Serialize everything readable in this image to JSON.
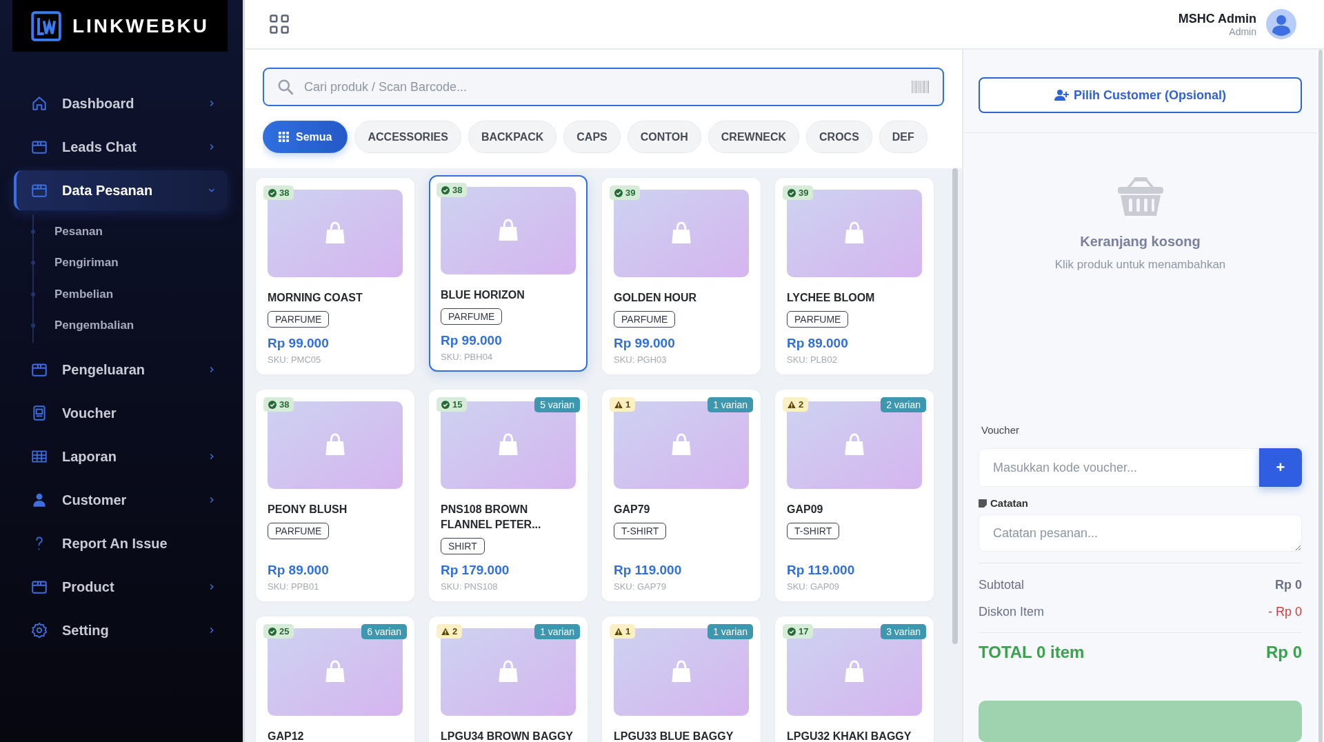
{
  "brand": {
    "name": "LINKWEBKU"
  },
  "sidebar": {
    "items": [
      {
        "label": "Dashboard",
        "kind": "home",
        "selected": false,
        "expanded": false
      },
      {
        "label": "Leads Chat",
        "kind": "box",
        "selected": false,
        "expanded": false
      },
      {
        "label": "Data Pesanan",
        "kind": "box",
        "selected": true,
        "expanded": true,
        "children": [
          {
            "label": "Pesanan"
          },
          {
            "label": "Pengiriman"
          },
          {
            "label": "Pembelian"
          },
          {
            "label": "Pengembalian"
          }
        ]
      },
      {
        "label": "Pengeluaran",
        "kind": "box",
        "selected": false,
        "expanded": false
      },
      {
        "label": "Voucher",
        "kind": "receipt",
        "selected": false
      },
      {
        "label": "Laporan",
        "kind": "table",
        "selected": false,
        "expanded": false
      },
      {
        "label": "Customer",
        "kind": "user",
        "selected": false,
        "expanded": false
      },
      {
        "label": "Report An Issue",
        "kind": "question",
        "selected": false
      },
      {
        "label": "Product",
        "kind": "box",
        "selected": false,
        "expanded": false
      },
      {
        "label": "Setting",
        "kind": "gear",
        "selected": false,
        "expanded": false
      }
    ]
  },
  "user": {
    "name": "MSHC Admin",
    "role": "Admin"
  },
  "search": {
    "placeholder": "Cari produk / Scan Barcode..."
  },
  "categories": [
    {
      "label": "Semua",
      "selected": true
    },
    {
      "label": "ACCESSORIES",
      "selected": false
    },
    {
      "label": "BACKPACK",
      "selected": false
    },
    {
      "label": "CAPS",
      "selected": false
    },
    {
      "label": "CONTOH",
      "selected": false
    },
    {
      "label": "CREWNECK",
      "selected": false
    },
    {
      "label": "CROCS",
      "selected": false
    },
    {
      "label": "DEF",
      "selected": false
    }
  ],
  "products": [
    {
      "name": "MORNING COAST",
      "stock": {
        "kind": "ok",
        "count": "38"
      },
      "category": "PARFUME",
      "price": "Rp 99.000",
      "sku": "SKU: PMC05",
      "selected": false
    },
    {
      "name": "BLUE HORIZON",
      "stock": {
        "kind": "ok",
        "count": "38"
      },
      "category": "PARFUME",
      "price": "Rp 99.000",
      "sku": "SKU: PBH04",
      "selected": true
    },
    {
      "name": "GOLDEN HOUR",
      "stock": {
        "kind": "ok",
        "count": "39"
      },
      "category": "PARFUME",
      "price": "Rp 99.000",
      "sku": "SKU: PGH03",
      "selected": false
    },
    {
      "name": "LYCHEE BLOOM",
      "stock": {
        "kind": "ok",
        "count": "39"
      },
      "category": "PARFUME",
      "price": "Rp 89.000",
      "sku": "SKU: PLB02",
      "selected": false
    },
    {
      "name": "PEONY BLUSH",
      "stock": {
        "kind": "ok",
        "count": "38"
      },
      "category": "PARFUME",
      "price": "Rp 89.000",
      "sku": "SKU: PPB01",
      "selected": false
    },
    {
      "name": "PNS108 BROWN FLANNEL PETER...",
      "stock": {
        "kind": "ok",
        "count": "15"
      },
      "variants": "5 varian",
      "category": "SHIRT",
      "price": "Rp 179.000",
      "sku": "SKU: PNS108",
      "selected": false
    },
    {
      "name": "GAP79",
      "stock": {
        "kind": "low",
        "count": "1"
      },
      "variants": "1 varian",
      "category": "T-SHIRT",
      "price": "Rp 119.000",
      "sku": "SKU: GAP79",
      "selected": false
    },
    {
      "name": "GAP09",
      "stock": {
        "kind": "low",
        "count": "2"
      },
      "variants": "2 varian",
      "category": "T-SHIRT",
      "price": "Rp 119.000",
      "sku": "SKU: GAP09",
      "selected": false
    },
    {
      "name": "GAP12",
      "stock": {
        "kind": "ok",
        "count": "25"
      },
      "variants": "6 varian",
      "selected": false
    },
    {
      "name": "LPGU34 BROWN BAGGY",
      "stock": {
        "kind": "low",
        "count": "2"
      },
      "variants": "1 varian",
      "selected": false
    },
    {
      "name": "LPGU33 BLUE BAGGY",
      "stock": {
        "kind": "low",
        "count": "1"
      },
      "variants": "1 varian",
      "selected": false
    },
    {
      "name": "LPGU32 KHAKI BAGGY",
      "stock": {
        "kind": "ok",
        "count": "17"
      },
      "variants": "3 varian",
      "selected": false
    }
  ],
  "cart": {
    "customer_button": "Pilih Customer (Opsional)",
    "empty_title": "Keranjang kosong",
    "empty_hint": "Klik produk untuk menambahkan",
    "voucher_label": "Voucher",
    "voucher_placeholder": "Masukkan kode voucher...",
    "voucher_add": "+",
    "note_label": "Catatan",
    "note_placeholder": "Catatan pesanan...",
    "summary": [
      {
        "label": "Subtotal",
        "value": "Rp 0",
        "kind": "plain"
      },
      {
        "label": "Diskon Item",
        "value": "- Rp 0",
        "kind": "discount"
      }
    ],
    "total_label": "TOTAL 0 item",
    "total_value": "Rp 0"
  }
}
